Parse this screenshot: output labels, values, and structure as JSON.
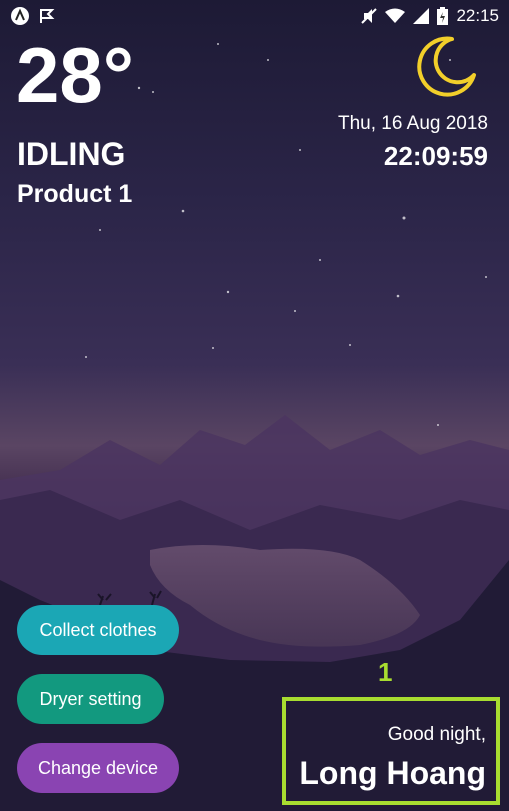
{
  "status_bar": {
    "left_icons": [
      "app-a-icon",
      "check-flag-icon"
    ],
    "right_icons": [
      "mute-icon",
      "wifi-icon",
      "signal-icon",
      "battery-charging-icon"
    ],
    "time": "22:15"
  },
  "weather": {
    "temperature": "28°",
    "state": "IDLING",
    "product": "Product 1",
    "icon": "moon-icon",
    "icon_color": "#f2cf2a"
  },
  "datetime": {
    "date": "Thu, 16 Aug 2018",
    "time": "22:09:59"
  },
  "actions": {
    "collect_label": "Collect clothes",
    "dryer_label": "Dryer setting",
    "change_label": "Change device",
    "collect_color": "#1ba7b5",
    "dryer_color": "#12997f",
    "change_color": "#8a44b2"
  },
  "annotation": {
    "marker": "1",
    "color": "#a8dd30"
  },
  "greeting": {
    "line": "Good night,",
    "name": "Long Hoang"
  }
}
